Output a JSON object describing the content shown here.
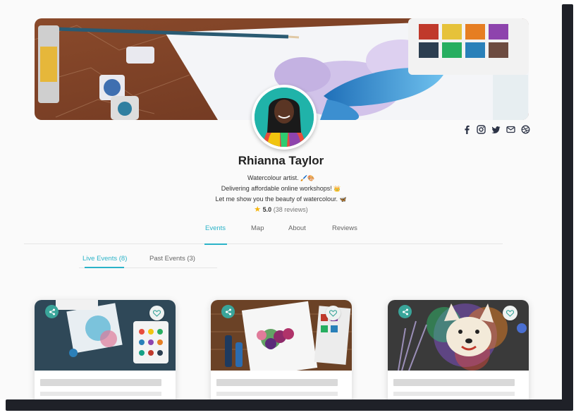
{
  "profile": {
    "name": "Rhianna Taylor",
    "bio_line1": "Watercolour artist.",
    "bio_line1_emoji": "🖌️🎨",
    "bio_line2": "Delivering affordable online workshops!",
    "bio_line2_emoji": "👑",
    "bio_line3": "Let me show you the beauty of watercolour.",
    "bio_line3_emoji": "🦋",
    "rating_score": "5.0",
    "rating_count": "(38 reviews)",
    "rating_star": "★"
  },
  "socials": [
    "facebook-icon",
    "instagram-icon",
    "twitter-icon",
    "mail-icon",
    "dribbble-icon"
  ],
  "tabs": {
    "events": "Events",
    "map": "Map",
    "about": "About",
    "reviews": "Reviews",
    "active": "Events"
  },
  "subtabs": {
    "live": "Live Events (8)",
    "past": "Past Events (3)",
    "active": "Live Events (8)"
  },
  "colors": {
    "accent": "#2bb3c8",
    "avatar_ring": "#20b3a9",
    "share_badge": "#3aa59a",
    "skeleton": "#d9d9d9",
    "star": "#f5b50a"
  },
  "cards": [
    {
      "image": "watercolour-palette-photo"
    },
    {
      "image": "berries-painting-photo"
    },
    {
      "image": "dog-portrait-photo"
    }
  ]
}
